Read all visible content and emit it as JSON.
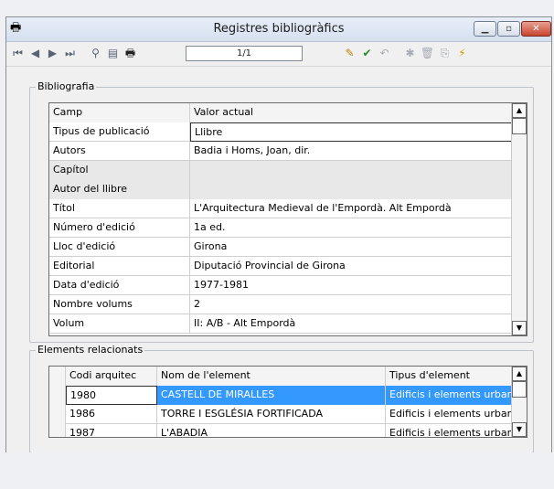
{
  "window": {
    "title": "Registres bibliogràfics"
  },
  "toolbar": {
    "record_counter": "1/1"
  },
  "bibliografia": {
    "label": "Bibliografia",
    "columns": [
      "Camp",
      "Valor actual"
    ],
    "rows": [
      {
        "field": "Tipus de publicació",
        "value": "Llibre"
      },
      {
        "field": "Autors",
        "value": "Badia i Homs, Joan, dir."
      },
      {
        "field": "Capítol",
        "value": ""
      },
      {
        "field": "Autor del llibre",
        "value": ""
      },
      {
        "field": "Títol",
        "value": "L'Arquitectura Medieval de l'Empordà. Alt Empordà"
      },
      {
        "field": "Número d'edició",
        "value": "1a ed."
      },
      {
        "field": "Lloc d'edició",
        "value": "Girona"
      },
      {
        "field": "Editorial",
        "value": "Diputació Provincial de Girona"
      },
      {
        "field": "Data d'edició",
        "value": "1977-1981"
      },
      {
        "field": "Nombre volums",
        "value": "2"
      },
      {
        "field": "Volum",
        "value": "II: A/B - Alt Empordà"
      }
    ]
  },
  "elements": {
    "label": "Elements relacionats",
    "columns": [
      "Codi arquitec",
      "Nom de l'element",
      "Tipus d'element"
    ],
    "rows": [
      {
        "code": "1980",
        "name": "CASTELL DE MIRALLES",
        "type": "Edificis i elements urbans"
      },
      {
        "code": "1986",
        "name": "TORRE I ESGLÉSIA FORTIFICADA",
        "type": "Edificis i elements urbans"
      },
      {
        "code": "1987",
        "name": "L'ABADIA",
        "type": "Edificis i elements urbans"
      }
    ]
  }
}
